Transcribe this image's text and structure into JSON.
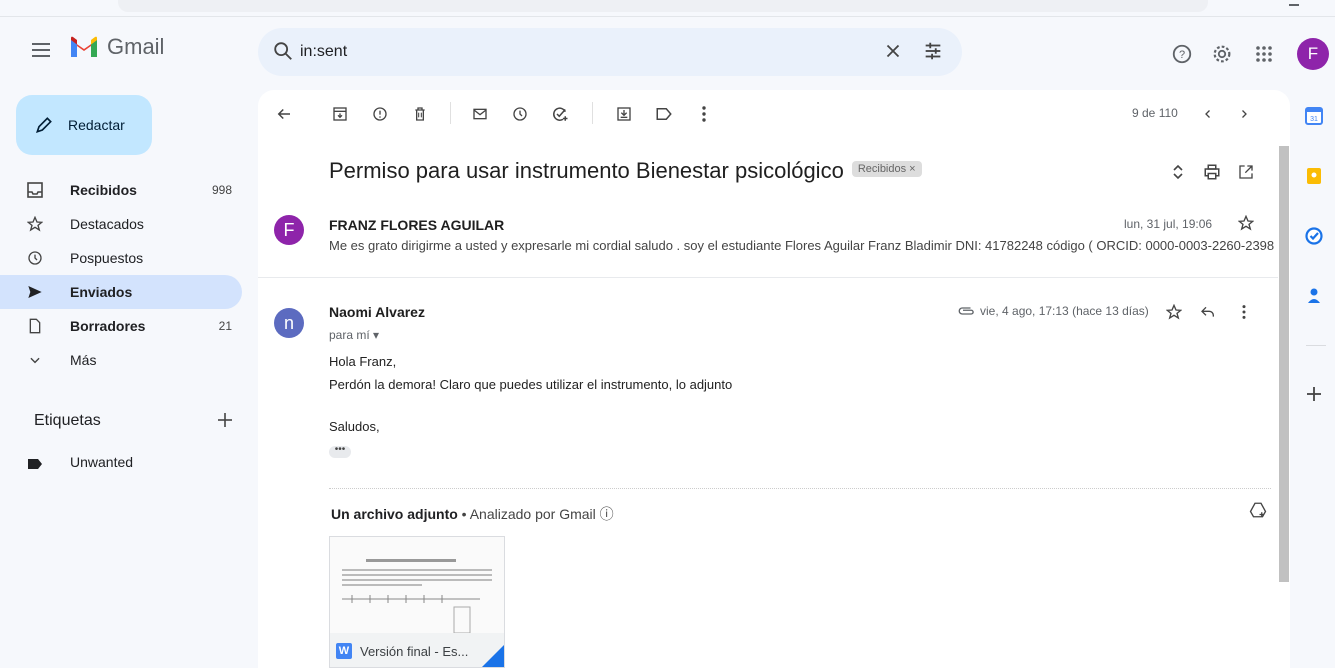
{
  "app": {
    "name": "Gmail"
  },
  "search": {
    "value": "in:sent"
  },
  "compose": {
    "label": "Redactar"
  },
  "sidebar": {
    "items": [
      {
        "label": "Recibidos",
        "count": "998",
        "icon": "inbox-icon",
        "bold": true
      },
      {
        "label": "Destacados",
        "count": "",
        "icon": "star-icon"
      },
      {
        "label": "Pospuestos",
        "count": "",
        "icon": "clock-icon"
      },
      {
        "label": "Enviados",
        "count": "",
        "icon": "send-icon",
        "active": true
      },
      {
        "label": "Borradores",
        "count": "21",
        "icon": "draft-icon",
        "bold": true
      },
      {
        "label": "Más",
        "count": "",
        "icon": "chevron-down-icon"
      }
    ],
    "labels_title": "Etiquetas",
    "labels": [
      {
        "label": "Unwanted",
        "icon": "label-icon"
      }
    ]
  },
  "toolbar": {
    "pager": "9 de 110"
  },
  "thread": {
    "subject": "Permiso para usar instrumento Bienestar psicológico",
    "label_chip": "Recibidos ×",
    "messages": [
      {
        "sender": "FRANZ FLORES AGUILAR",
        "avatar_letter": "F",
        "avatar_color": "#8e24aa",
        "date": "lun, 31 jul, 19:06",
        "snippet": "Me es grato dirigirme a usted y expresarle mi cordial saludo . soy el estudiante Flores Aguilar Franz Bladimir DNI: 41782248 código ( ORCID: 0000-0003-2260-2398"
      },
      {
        "sender": "Naomi Alvarez",
        "avatar_letter": "n",
        "avatar_color": "#5c6bc0",
        "to": "para mí ▾",
        "date": "vie, 4 ago, 17:13 (hace 13 días)",
        "body": [
          "Hola Franz,",
          "Perdón la demora! Claro que puedes utilizar el instrumento, lo adjunto",
          "Saludos,"
        ],
        "ellipsis": "•••"
      }
    ],
    "attachments": {
      "title": "Un archivo adjunto",
      "subtitle": " • Analizado por Gmail ⓘ",
      "file_name": "Versión final - Es...",
      "file_type_letter": "W"
    }
  },
  "profile": {
    "letter": "F",
    "color": "#8e24aa"
  }
}
